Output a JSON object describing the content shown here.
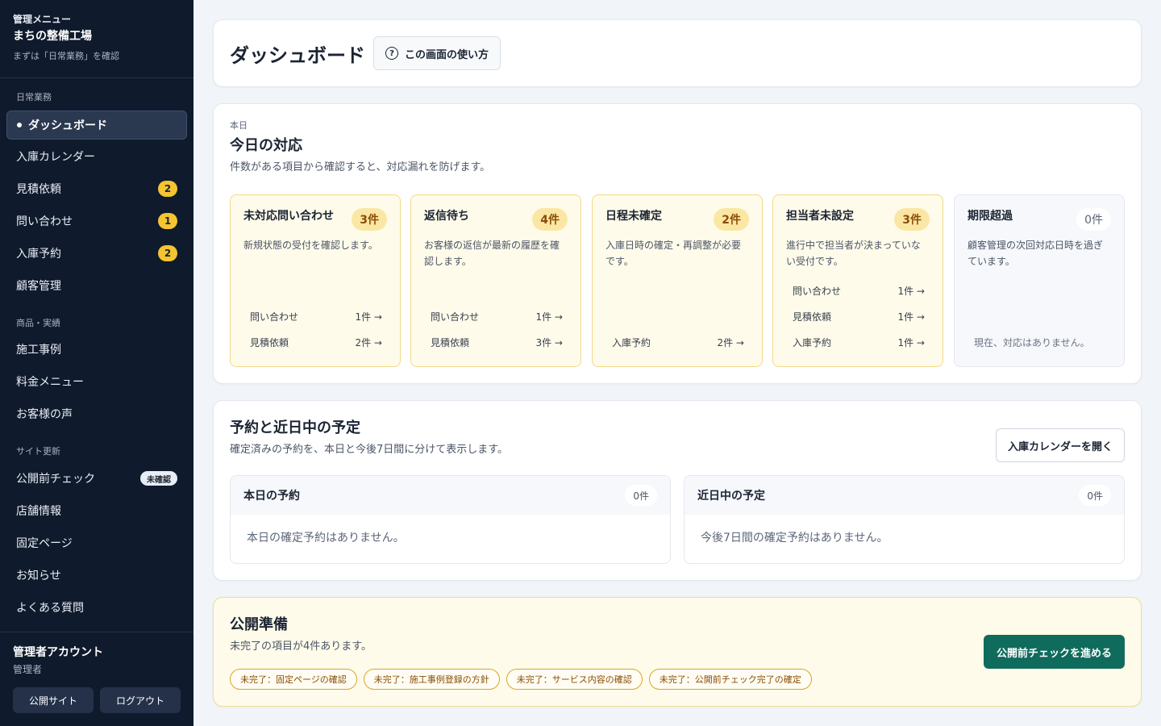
{
  "sidebar": {
    "eyebrow": "管理メニュー",
    "shop_name": "まちの整備工場",
    "hint": "まずは「日常業務」を確認",
    "sections": [
      {
        "heading": "日常業務",
        "items": [
          {
            "label": "ダッシュボード",
            "active": true
          },
          {
            "label": "入庫カレンダー"
          },
          {
            "label": "見積依頼",
            "badge": "2"
          },
          {
            "label": "問い合わせ",
            "badge": "1"
          },
          {
            "label": "入庫予約",
            "badge": "2"
          },
          {
            "label": "顧客管理"
          }
        ]
      },
      {
        "heading": "商品・実績",
        "items": [
          {
            "label": "施工事例"
          },
          {
            "label": "料金メニュー"
          },
          {
            "label": "お客様の声"
          }
        ]
      },
      {
        "heading": "サイト更新",
        "items": [
          {
            "label": "公開前チェック",
            "pill": "未確認"
          },
          {
            "label": "店舗情報"
          },
          {
            "label": "固定ページ"
          },
          {
            "label": "お知らせ"
          },
          {
            "label": "よくある質問"
          }
        ]
      }
    ],
    "account": {
      "name": "管理者アカウント",
      "role": "管理者",
      "public_site": "公開サイト",
      "logout": "ログアウト"
    }
  },
  "header": {
    "title": "ダッシュボード",
    "help": "この画面の使い方",
    "help_icon": "question-circle-icon"
  },
  "today": {
    "eyebrow": "本日",
    "title": "今日の対応",
    "desc": "件数がある項目から確認すると、対応漏れを防げます。",
    "tiles": [
      {
        "title": "未対応問い合わせ",
        "count": "3件",
        "desc": "新規状態の受付を確認します。",
        "links": [
          {
            "label": "問い合わせ",
            "value": "1件 →"
          },
          {
            "label": "見積依頼",
            "value": "2件 →"
          }
        ]
      },
      {
        "title": "返信待ち",
        "count": "4件",
        "desc": "お客様の返信が最新の履歴を確認します。",
        "links": [
          {
            "label": "問い合わせ",
            "value": "1件 →"
          },
          {
            "label": "見積依頼",
            "value": "3件 →"
          }
        ]
      },
      {
        "title": "日程未確定",
        "count": "2件",
        "desc": "入庫日時の確定・再調整が必要です。",
        "links": [
          {
            "label": "入庫予約",
            "value": "2件 →"
          }
        ]
      },
      {
        "title": "担当者未設定",
        "count": "3件",
        "desc": "進行中で担当者が決まっていない受付です。",
        "links": [
          {
            "label": "問い合わせ",
            "value": "1件 →"
          },
          {
            "label": "見積依頼",
            "value": "1件 →"
          },
          {
            "label": "入庫予約",
            "value": "1件 →"
          }
        ]
      },
      {
        "title": "期限超過",
        "count": "0件",
        "desc": "顧客管理の次回対応日時を過ぎています。",
        "empty": "現在、対応はありません。",
        "links": []
      }
    ]
  },
  "schedule": {
    "title": "予約と近日中の予定",
    "desc": "確定済みの予約を、本日と今後7日間に分けて表示します。",
    "calendar_button": "入庫カレンダーを開く",
    "panels": [
      {
        "title": "本日の予約",
        "count": "0件",
        "empty": "本日の確定予約はありません。"
      },
      {
        "title": "近日中の予定",
        "count": "0件",
        "empty": "今後7日間の確定予約はありません。"
      }
    ]
  },
  "prep": {
    "title": "公開準備",
    "desc": "未完了の項目が4件あります。",
    "button": "公開前チェックを進める",
    "chips": [
      "未完了：固定ページの確認",
      "未完了：施工事例登録の方針",
      "未完了：サービス内容の確認",
      "未完了：公開前チェック完了の確定"
    ]
  },
  "colors": {
    "sidebar_bg": "#0f1a2c",
    "accent_yellow": "#f5c431",
    "primary_green": "#0f6b5c",
    "tile_warm_bg": "#fffbea"
  }
}
